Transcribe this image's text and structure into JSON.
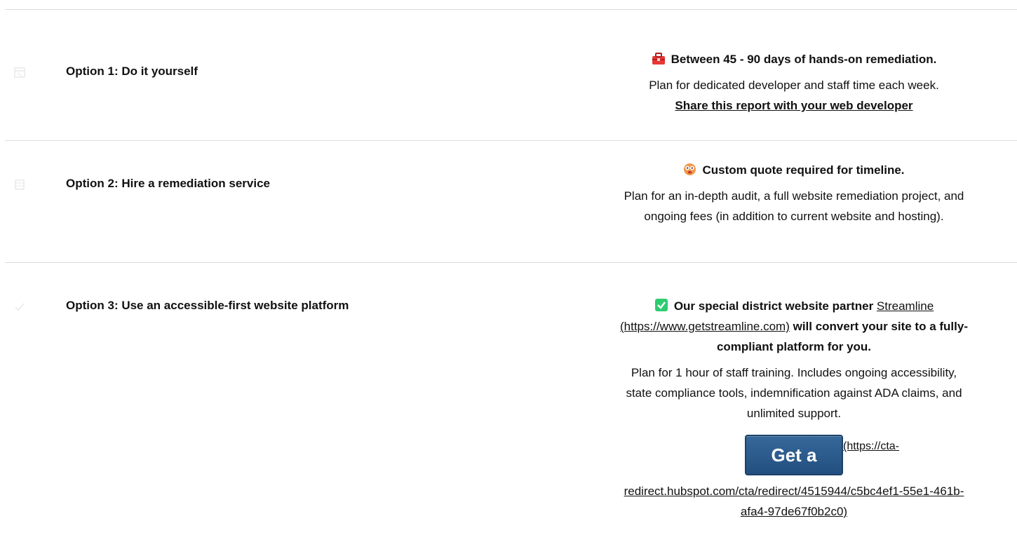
{
  "options": [
    {
      "icon": "calendar-icon",
      "title": "Option 1: Do it yourself",
      "headline": "Between 45 - 90 days of hands-on remediation.",
      "headline_icon": "toolbox-icon",
      "body": "Plan for dedicated developer and staff time each week.",
      "link": "Share this report with your web developer"
    },
    {
      "icon": "building-icon",
      "title": "Option 2: Hire a remediation service",
      "headline": "Custom quote required for timeline.",
      "headline_icon": "dizzy-face-icon",
      "body_line1": "Plan for an in-depth audit, a full website remediation project, and",
      "body_line2": "ongoing fees (in addition to current website and hosting)."
    },
    {
      "icon": "check-icon",
      "title": "Option 3: Use an accessible-first website platform",
      "headline_icon": "green-check-icon",
      "headline_prefix": "Our special district website partner",
      "headline_link_line1": "Streamline",
      "headline_link_line2": "(https://www.getstreamline.com)",
      "headline_suffix_line2": "will convert your site to a fully-",
      "headline_suffix_line3": "compliant platform for you.",
      "body_line1": "Plan for 1 hour of staff training. Includes ongoing accessibility,",
      "body_line2": "state compliance tools, indemnification against ADA claims, and",
      "body_line3": "unlimited support.",
      "cta_label": "Get a Quote",
      "cta_link_line1": "(https://cta-",
      "cta_link_line2": "redirect.hubspot.com/cta/redirect/4515944/c5bc4ef1-55e1-461b-",
      "cta_link_line3": "afa4-97de67f0b2c0)"
    }
  ],
  "colors": {
    "toolbox": "#e53935",
    "check_green": "#2ecc71",
    "cta_blue": "#2b5a8a"
  }
}
